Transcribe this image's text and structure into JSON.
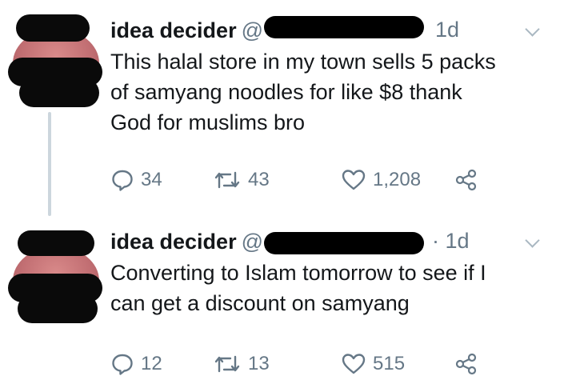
{
  "tweets": [
    {
      "name": "idea decider",
      "handle": "@",
      "time": "1d",
      "text_lines": [
        "This halal store in my town sells 5 packs",
        "of samyang noodles for like $8 thank",
        "God for muslims bro"
      ],
      "replies": "34",
      "retweets": "43",
      "likes": "1,208"
    },
    {
      "name": "idea decider",
      "handle": "@",
      "time": "· 1d",
      "text_lines": [
        "Converting to Islam tomorrow to see if I",
        "can get a discount on samyang"
      ],
      "replies": "12",
      "retweets": "13",
      "likes": "515"
    }
  ],
  "icons": {
    "reply": "reply-icon",
    "retweet": "retweet-icon",
    "like": "heart-icon",
    "share": "share-icon",
    "menu": "chevron-down-icon"
  },
  "colors": {
    "text": "#14171a",
    "secondary": "#657786",
    "thread_line": "#ccd6dd"
  }
}
